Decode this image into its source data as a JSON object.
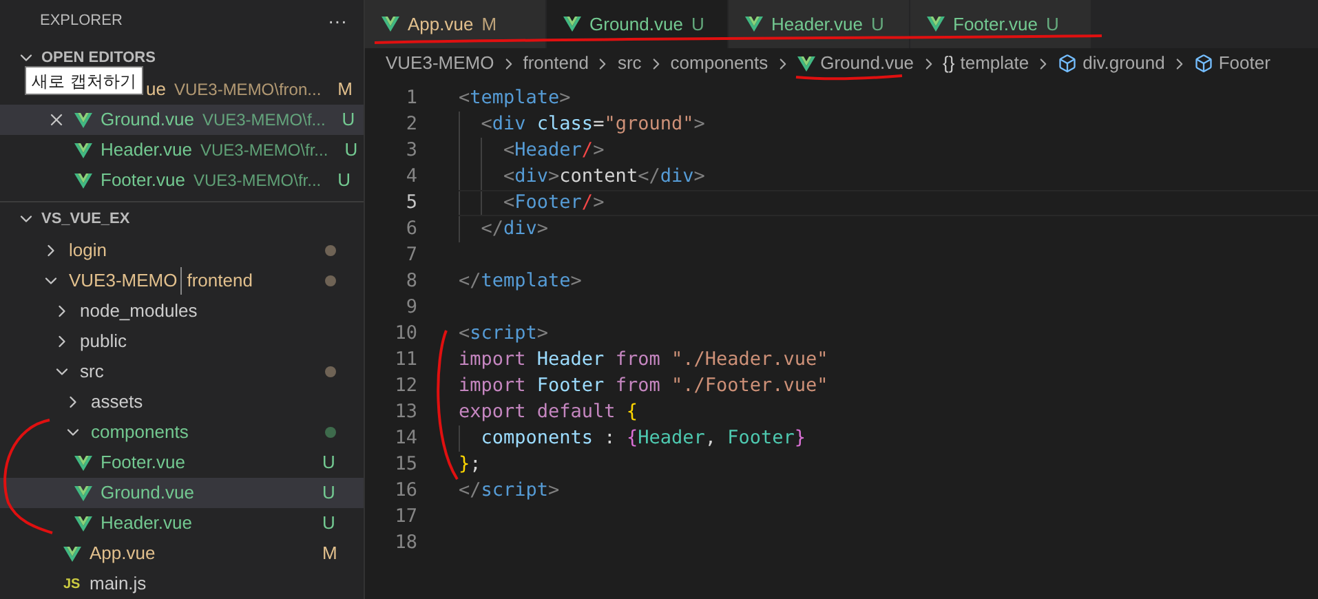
{
  "sidebar": {
    "title": "EXPLORER",
    "more": "···",
    "open_editors": {
      "title": "OPEN EDITORS",
      "expanded": true,
      "tooltip": "새로 캡처하기",
      "items": [
        {
          "name": "ue",
          "path": "VUE3-MEMO\\fron...",
          "badge": "M",
          "color": "#e2c08d",
          "selected": false
        },
        {
          "name": "Ground.vue",
          "path": "VUE3-MEMO\\f...",
          "badge": "U",
          "color": "#73c991",
          "selected": true
        },
        {
          "name": "Header.vue",
          "path": "VUE3-MEMO\\fr...",
          "badge": "U",
          "color": "#73c991",
          "selected": false
        },
        {
          "name": "Footer.vue",
          "path": "VUE3-MEMO\\fr...",
          "badge": "U",
          "color": "#73c991",
          "selected": false
        }
      ]
    },
    "workspace": {
      "title": "VS_VUE_EX",
      "expanded": true,
      "children": [
        {
          "kind": "folder",
          "name": "login",
          "expanded": false,
          "color": "#e2c08d",
          "dot": {
            "color": "#6f6355"
          },
          "selected": false
        },
        {
          "kind": "folder",
          "name": "VUE3-MEMO",
          "name_suffix": "frontend",
          "expanded": true,
          "color": "#e2c08d",
          "dot": {
            "color": "#6f6355"
          },
          "selected": false,
          "children": [
            {
              "kind": "folder",
              "name": "node_modules",
              "expanded": false,
              "color": "#cccccc",
              "selected": false
            },
            {
              "kind": "folder",
              "name": "public",
              "expanded": false,
              "color": "#cccccc",
              "selected": false
            },
            {
              "kind": "folder",
              "name": "src",
              "expanded": true,
              "color": "#cccccc",
              "dot": {
                "color": "#6f6355"
              },
              "selected": false,
              "children": [
                {
                  "kind": "folder",
                  "name": "assets",
                  "expanded": false,
                  "color": "#cccccc",
                  "selected": false
                },
                {
                  "kind": "folder",
                  "name": "components",
                  "expanded": true,
                  "color": "#73c991",
                  "dot": {
                    "color": "#3e6b4c"
                  },
                  "selected": false,
                  "children": [
                    {
                      "kind": "vue_file",
                      "name": "Footer.vue",
                      "badge": "U",
                      "color": "#73c991",
                      "selected": false
                    },
                    {
                      "kind": "vue_file",
                      "name": "Ground.vue",
                      "badge": "U",
                      "color": "#73c991",
                      "selected": true
                    },
                    {
                      "kind": "vue_file",
                      "name": "Header.vue",
                      "badge": "U",
                      "color": "#73c991",
                      "selected": false
                    }
                  ]
                },
                {
                  "kind": "vue_file",
                  "name": "App.vue",
                  "badge": "M",
                  "color": "#e2c08d",
                  "selected": false
                },
                {
                  "kind": "js_file",
                  "icon_text": "JS",
                  "name": "main.js",
                  "color": "#cccccc",
                  "selected": false
                }
              ]
            }
          ]
        }
      ]
    }
  },
  "tabs": [
    {
      "label": "App.vue",
      "badge": "M",
      "color": "#e2c08d",
      "selected": false
    },
    {
      "label": "Ground.vue",
      "badge": "U",
      "color": "#73c991",
      "selected": true
    },
    {
      "label": "Header.vue",
      "badge": "U",
      "color": "#73c991",
      "selected": false
    },
    {
      "label": "Footer.vue",
      "badge": "U",
      "color": "#73c991",
      "selected": false
    }
  ],
  "breadcrumb": [
    {
      "kind": "text",
      "label": "VUE3-MEMO"
    },
    {
      "kind": "text",
      "label": "frontend"
    },
    {
      "kind": "text",
      "label": "src"
    },
    {
      "kind": "text",
      "label": "components"
    },
    {
      "kind": "vue",
      "label": "Ground.vue"
    },
    {
      "kind": "braces",
      "icon_text": "{}",
      "label": "template"
    },
    {
      "kind": "element",
      "label": "div.ground"
    },
    {
      "kind": "element",
      "label": "Footer"
    }
  ],
  "editor": {
    "lines": [
      {
        "number": "1",
        "tokens": [
          {
            "kind": "punct",
            "text": "<"
          },
          {
            "kind": "tag",
            "text": "template"
          },
          {
            "kind": "punct",
            "text": ">"
          }
        ]
      },
      {
        "number": "2",
        "tokens": [
          {
            "kind": "punct",
            "text": "  <"
          },
          {
            "kind": "tag",
            "text": "div"
          },
          {
            "kind": "attr",
            "text": " class"
          },
          {
            "kind": "text",
            "text": "="
          },
          {
            "kind": "string",
            "text": "\"ground\""
          },
          {
            "kind": "punct",
            "text": ">"
          }
        ]
      },
      {
        "number": "3",
        "tokens": [
          {
            "kind": "punct",
            "text": "    <"
          },
          {
            "kind": "tag",
            "text": "Header"
          },
          {
            "kind": "slash",
            "text": "/"
          },
          {
            "kind": "punct",
            "text": ">"
          }
        ]
      },
      {
        "number": "4",
        "tokens": [
          {
            "kind": "punct",
            "text": "    <"
          },
          {
            "kind": "tag",
            "text": "div"
          },
          {
            "kind": "punct",
            "text": ">"
          },
          {
            "kind": "text",
            "text": "content"
          },
          {
            "kind": "punct",
            "text": "</"
          },
          {
            "kind": "tag",
            "text": "div"
          },
          {
            "kind": "punct",
            "text": ">"
          }
        ]
      },
      {
        "number": "5",
        "current": true,
        "tokens": [
          {
            "kind": "punct",
            "text": "    <"
          },
          {
            "kind": "tag",
            "text": "Footer"
          },
          {
            "kind": "slash",
            "text": "/"
          },
          {
            "kind": "punct",
            "text": ">"
          }
        ]
      },
      {
        "number": "6",
        "tokens": [
          {
            "kind": "punct",
            "text": "  </"
          },
          {
            "kind": "tag",
            "text": "div"
          },
          {
            "kind": "punct",
            "text": ">"
          }
        ]
      },
      {
        "number": "7"
      },
      {
        "number": "8",
        "tokens": [
          {
            "kind": "punct",
            "text": "</"
          },
          {
            "kind": "tag",
            "text": "template"
          },
          {
            "kind": "punct",
            "text": ">"
          }
        ]
      },
      {
        "number": "9"
      },
      {
        "number": "10",
        "tokens": [
          {
            "kind": "punct",
            "text": "<"
          },
          {
            "kind": "tag",
            "text": "script"
          },
          {
            "kind": "punct",
            "text": ">"
          }
        ]
      },
      {
        "number": "11",
        "tokens": [
          {
            "kind": "keyword",
            "text": "import"
          },
          {
            "kind": "ident",
            "text": " Header"
          },
          {
            "kind": "keyword",
            "text": " from"
          },
          {
            "kind": "string",
            "text": " \"./Header.vue\""
          }
        ]
      },
      {
        "number": "12",
        "tokens": [
          {
            "kind": "keyword",
            "text": "import"
          },
          {
            "kind": "ident",
            "text": " Footer"
          },
          {
            "kind": "keyword",
            "text": " from"
          },
          {
            "kind": "string",
            "text": " \"./Footer.vue\""
          }
        ]
      },
      {
        "number": "13",
        "tokens": [
          {
            "kind": "keyword",
            "text": "export default "
          },
          {
            "kind": "brace",
            "text": "{"
          }
        ]
      },
      {
        "number": "14",
        "tokens": [
          {
            "kind": "ident",
            "text": "  components"
          },
          {
            "kind": "text",
            "text": " : "
          },
          {
            "kind": "brace2",
            "text": "{"
          },
          {
            "kind": "component",
            "text": "Header"
          },
          {
            "kind": "text",
            "text": ", "
          },
          {
            "kind": "component",
            "text": "Footer"
          },
          {
            "kind": "brace2",
            "text": "}"
          }
        ]
      },
      {
        "number": "15",
        "tokens": [
          {
            "kind": "brace",
            "text": "}"
          },
          {
            "kind": "text",
            "text": ";"
          }
        ]
      },
      {
        "number": "16",
        "tokens": [
          {
            "kind": "punct",
            "text": "</"
          },
          {
            "kind": "tag",
            "text": "script"
          },
          {
            "kind": "punct",
            "text": ">"
          }
        ]
      },
      {
        "number": "17"
      },
      {
        "number": "18"
      }
    ]
  }
}
